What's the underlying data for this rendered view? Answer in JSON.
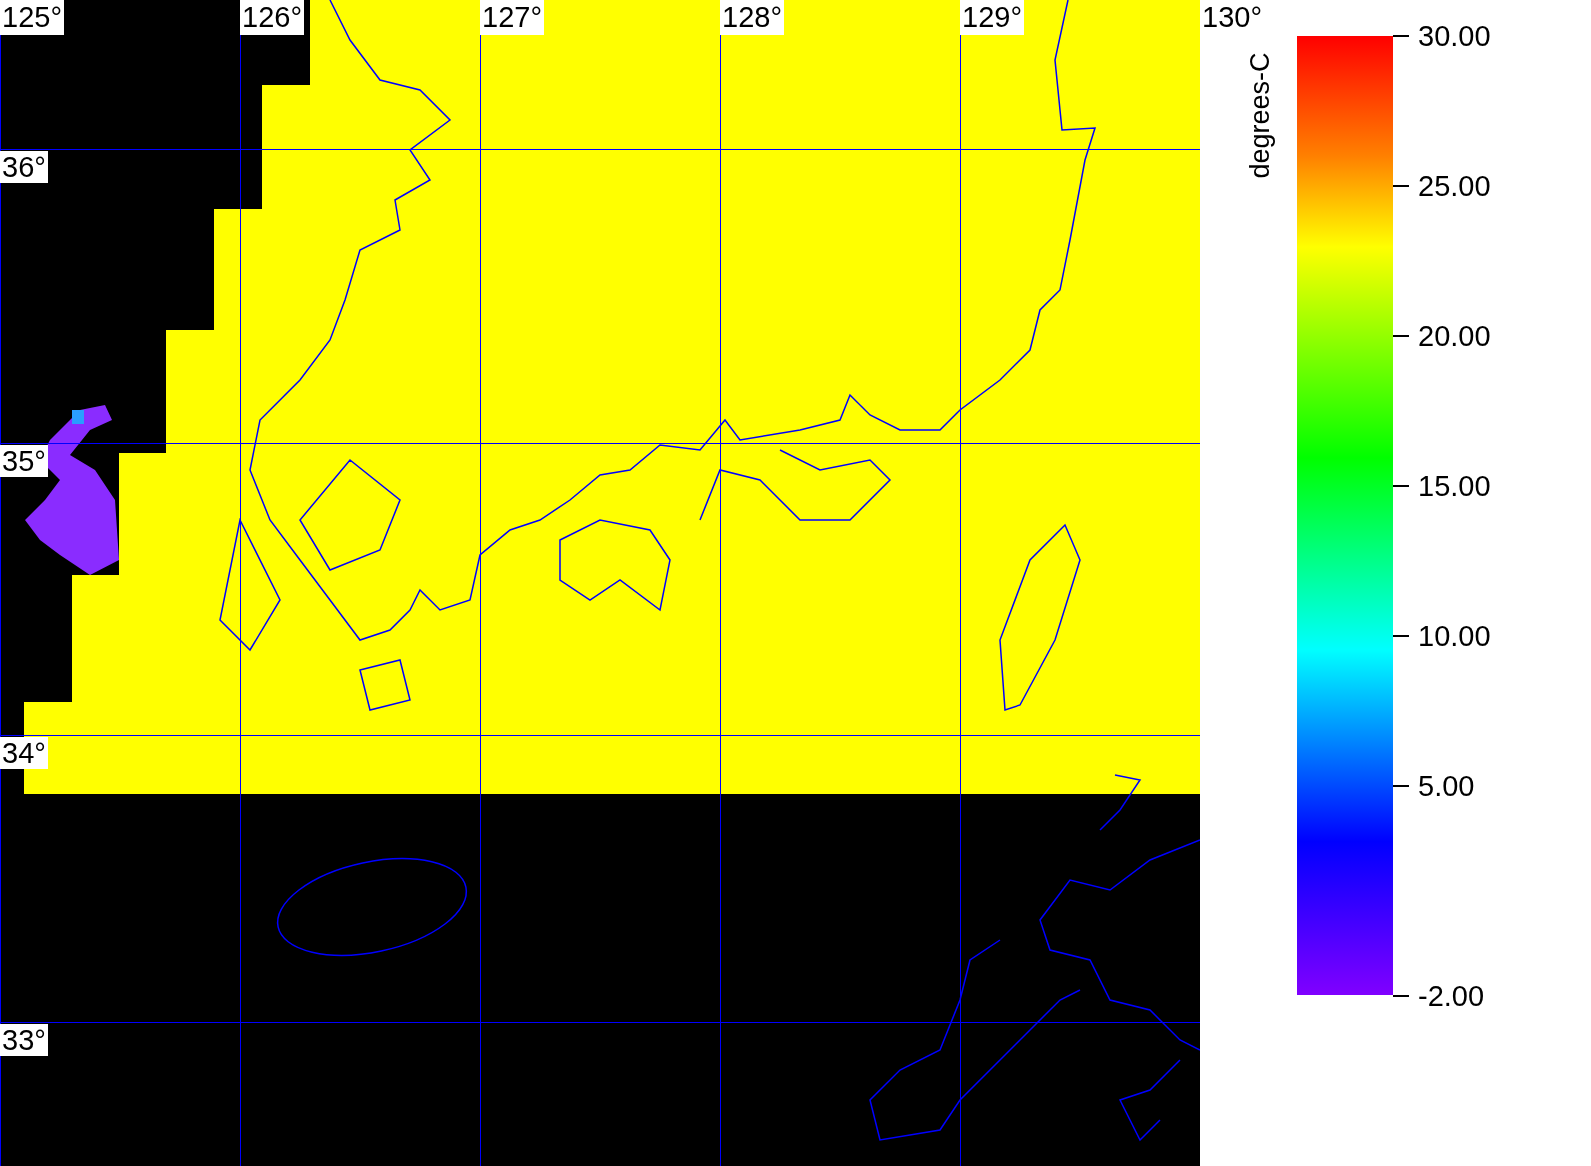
{
  "map": {
    "longitude_labels": [
      "125°",
      "126°",
      "127°",
      "128°",
      "129°",
      "130°"
    ],
    "latitude_labels": [
      "36°",
      "35°",
      "34°",
      "33°"
    ]
  },
  "colorbar": {
    "title": "degrees-C",
    "tick_labels": [
      "30.00",
      "25.00",
      "20.00",
      "15.00",
      "10.00",
      "5.00",
      "-2.00"
    ]
  }
}
